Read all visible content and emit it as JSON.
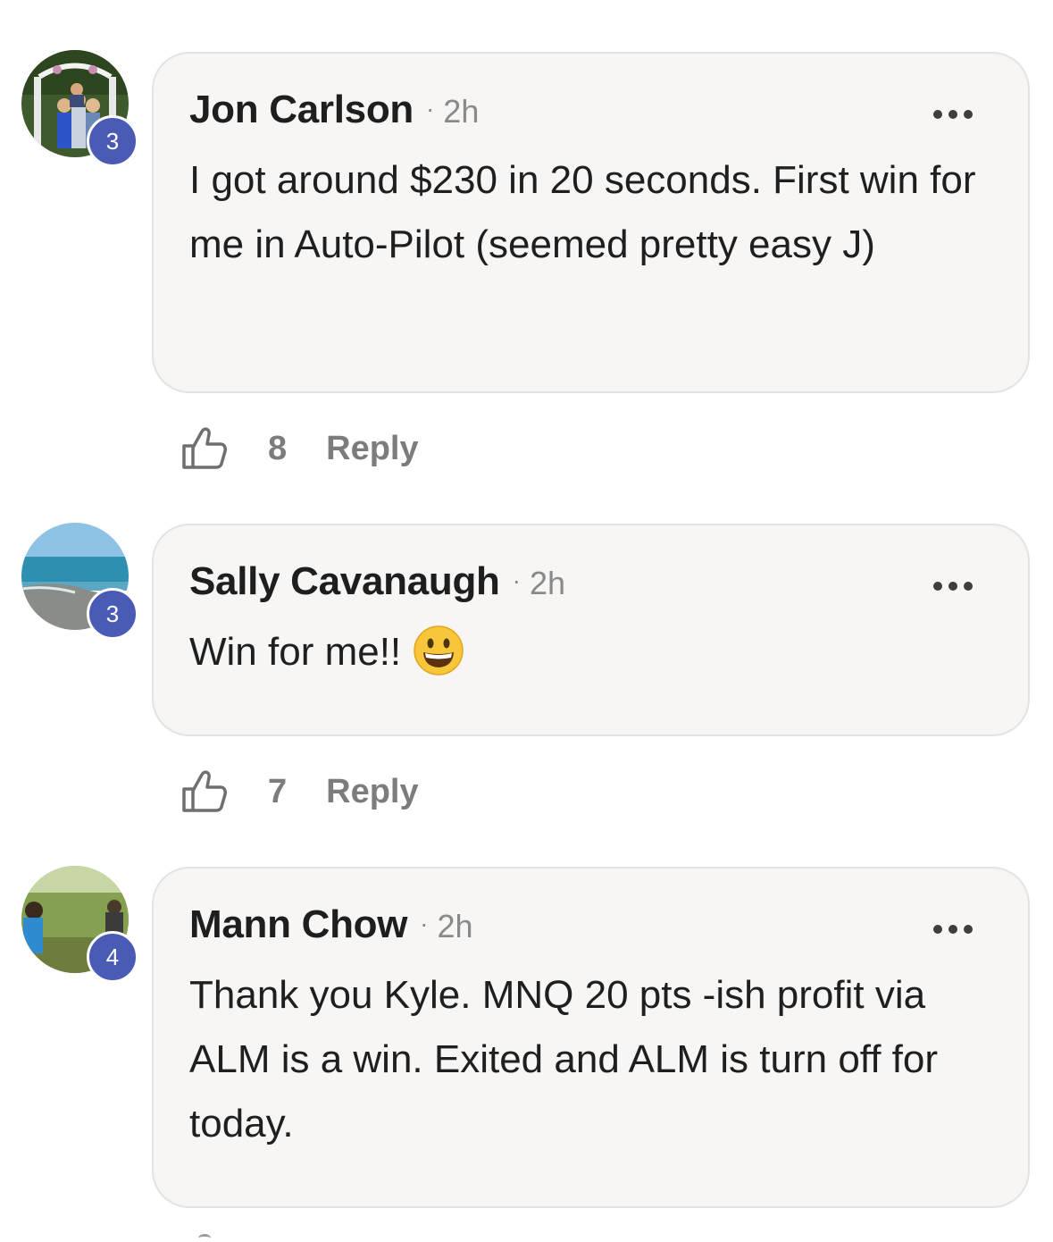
{
  "comments": [
    {
      "author": "Jon Carlson",
      "separator": "·",
      "time": "2h",
      "level": "3",
      "text": "I got around $230 in 20 seconds. First win for me in Auto-Pilot (seemed pretty easy J)",
      "likes": "8",
      "reply_label": "Reply",
      "avatar": "family-photo-avatar"
    },
    {
      "author": "Sally Cavanaugh",
      "separator": "·",
      "time": "2h",
      "level": "3",
      "text": "Win for me!!",
      "emoji": "grinning-face-emoji",
      "likes": "7",
      "reply_label": "Reply",
      "avatar": "ocean-photo-avatar"
    },
    {
      "author": "Mann Chow",
      "separator": "·",
      "time": "2h",
      "level": "4",
      "text": "Thank you Kyle. MNQ 20 pts -ish profit via ALM is a win. Exited and ALM is turn off for today.",
      "avatar": "outdoor-photo-avatar"
    }
  ],
  "colors": {
    "badge": "#4a5bb5",
    "bubble_bg": "#f7f6f4",
    "muted_text": "#7c7c7c"
  }
}
